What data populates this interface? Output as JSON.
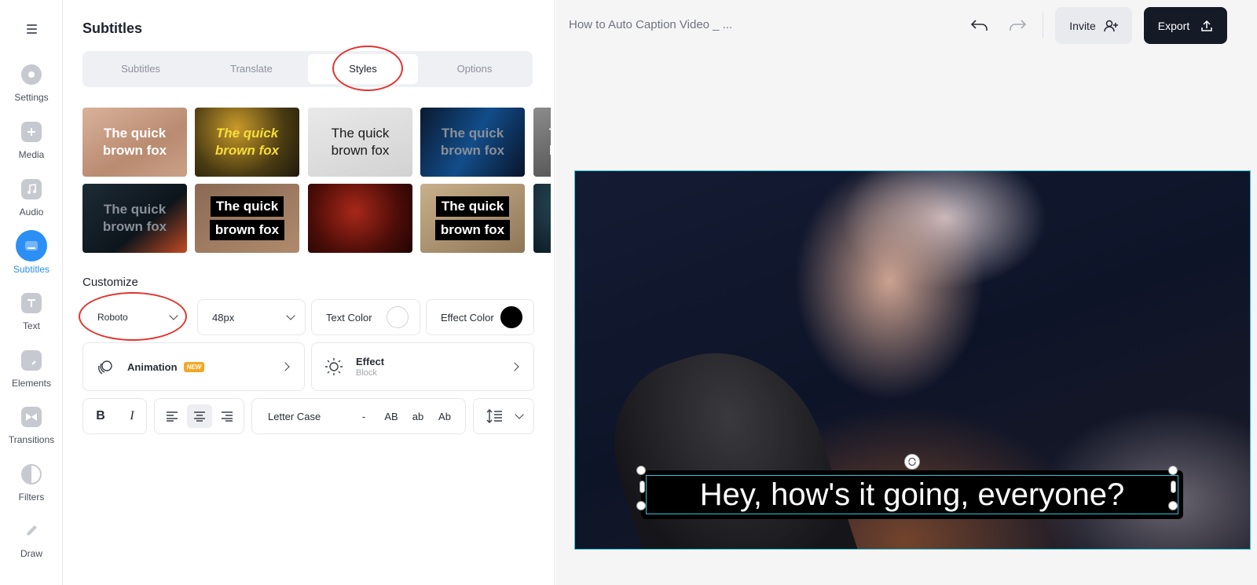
{
  "rail": {
    "items": [
      {
        "label": "Settings",
        "icon": "settings-icon"
      },
      {
        "label": "Media",
        "icon": "media-icon"
      },
      {
        "label": "Audio",
        "icon": "audio-icon"
      },
      {
        "label": "Subtitles",
        "icon": "subtitles-icon"
      },
      {
        "label": "Text",
        "icon": "text-icon"
      },
      {
        "label": "Elements",
        "icon": "elements-icon"
      },
      {
        "label": "Transitions",
        "icon": "transitions-icon"
      },
      {
        "label": "Filters",
        "icon": "filters-icon"
      },
      {
        "label": "Draw",
        "icon": "draw-icon"
      }
    ],
    "active": "Subtitles",
    "accent": "#2b8ff5"
  },
  "panel": {
    "title": "Subtitles",
    "tabs": [
      "Subtitles",
      "Translate",
      "Styles",
      "Options"
    ],
    "active_tab": "Styles",
    "style_presets": [
      {
        "line1": "The quick",
        "line2": "brown fox"
      },
      {
        "line1": "The quick",
        "line2": "brown fox"
      },
      {
        "line1": "The quick",
        "line2": "brown fox"
      },
      {
        "line1": "The quick",
        "line2": "brown fox"
      },
      {
        "line1": "T",
        "line2": "b"
      },
      {
        "line1": "The quick",
        "line2": "brown fox"
      },
      {
        "line1": "The quick",
        "line2": "brown fox"
      },
      {
        "line1": "",
        "line2": ""
      },
      {
        "line1": "The quick",
        "line2": "brown fox"
      }
    ],
    "customize": {
      "title": "Customize",
      "font": "Roboto",
      "size": "48px",
      "text_color_label": "Text Color",
      "text_color": "#ffffff",
      "effect_color_label": "Effect Color",
      "effect_color": "#000000",
      "animation_label": "Animation",
      "animation_badge": "NEW",
      "effect_label": "Effect",
      "effect_value": "Block",
      "bold": "B",
      "italic": "I",
      "letter_case_label": "Letter Case",
      "case_options": [
        "-",
        "AB",
        "ab",
        "Ab"
      ]
    }
  },
  "topbar": {
    "doc_title": "How to Auto Caption Video _ ...",
    "invite_label": "Invite",
    "export_label": "Export"
  },
  "video": {
    "caption": "Hey, how's it going, everyone?"
  },
  "colors": {
    "highlight_ring": "#e3342f",
    "selection": "#2fc3d6",
    "export_bg": "#141a26"
  }
}
